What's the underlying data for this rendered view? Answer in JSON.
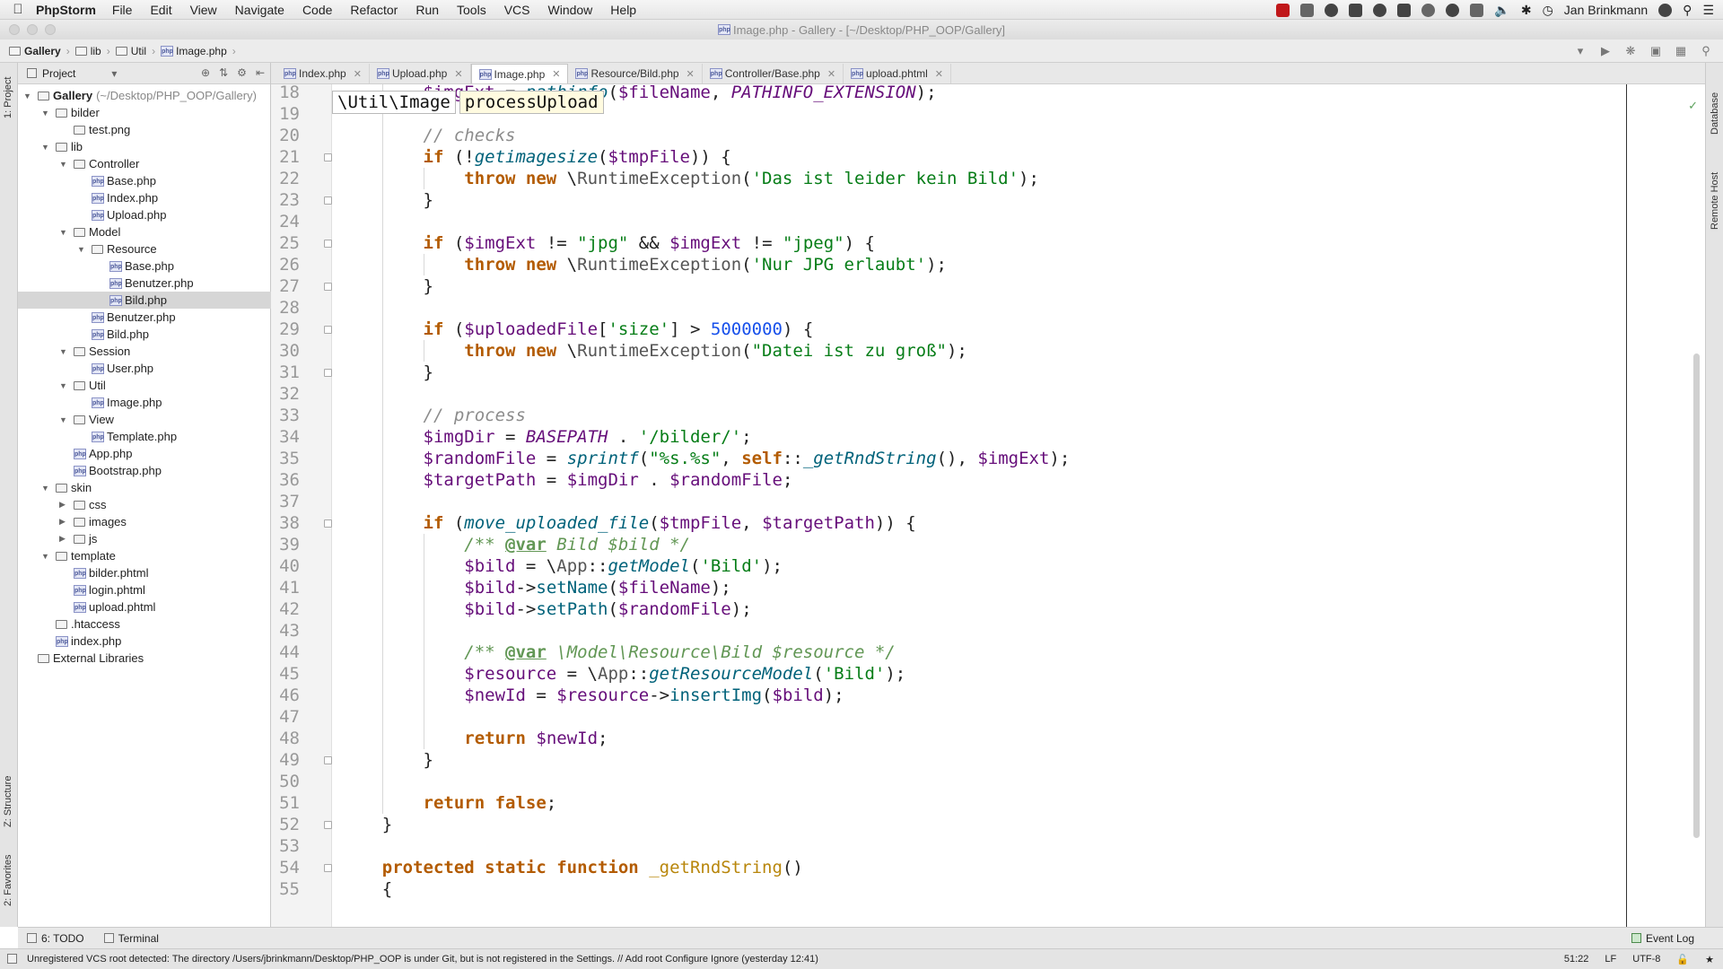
{
  "menubar": {
    "app_name": "PhpStorm",
    "items": [
      "File",
      "Edit",
      "View",
      "Navigate",
      "Code",
      "Refactor",
      "Run",
      "Tools",
      "VCS",
      "Window",
      "Help"
    ],
    "user": "Jan Brinkmann"
  },
  "window": {
    "title": "Image.php - Gallery - [~/Desktop/PHP_OOP/Gallery]"
  },
  "navbar": {
    "crumbs": [
      "Gallery",
      "lib",
      "Util",
      "Image.php"
    ]
  },
  "left_strip": {
    "project": "1: Project",
    "structure": "Z: Structure",
    "favorites": "2: Favorites"
  },
  "right_strip": {
    "database": "Database",
    "remote_host": "Remote Host"
  },
  "project_panel": {
    "title": "Project",
    "tree": [
      {
        "label": "Gallery",
        "hint": "(~/Desktop/PHP_OOP/Gallery)",
        "depth": 0,
        "type": "folder",
        "expanded": true,
        "bold": true
      },
      {
        "label": "bilder",
        "depth": 1,
        "type": "folder",
        "expanded": true
      },
      {
        "label": "test.png",
        "depth": 2,
        "type": "file"
      },
      {
        "label": "lib",
        "depth": 1,
        "type": "folder",
        "expanded": true
      },
      {
        "label": "Controller",
        "depth": 2,
        "type": "folder",
        "expanded": true
      },
      {
        "label": "Base.php",
        "depth": 3,
        "type": "php"
      },
      {
        "label": "Index.php",
        "depth": 3,
        "type": "php"
      },
      {
        "label": "Upload.php",
        "depth": 3,
        "type": "php"
      },
      {
        "label": "Model",
        "depth": 2,
        "type": "folder",
        "expanded": true
      },
      {
        "label": "Resource",
        "depth": 3,
        "type": "folder",
        "expanded": true
      },
      {
        "label": "Base.php",
        "depth": 4,
        "type": "php"
      },
      {
        "label": "Benutzer.php",
        "depth": 4,
        "type": "php"
      },
      {
        "label": "Bild.php",
        "depth": 4,
        "type": "php",
        "selected": true
      },
      {
        "label": "Benutzer.php",
        "depth": 3,
        "type": "php"
      },
      {
        "label": "Bild.php",
        "depth": 3,
        "type": "php"
      },
      {
        "label": "Session",
        "depth": 2,
        "type": "folder",
        "expanded": true
      },
      {
        "label": "User.php",
        "depth": 3,
        "type": "php"
      },
      {
        "label": "Util",
        "depth": 2,
        "type": "folder",
        "expanded": true
      },
      {
        "label": "Image.php",
        "depth": 3,
        "type": "php"
      },
      {
        "label": "View",
        "depth": 2,
        "type": "folder",
        "expanded": true
      },
      {
        "label": "Template.php",
        "depth": 3,
        "type": "php"
      },
      {
        "label": "App.php",
        "depth": 2,
        "type": "php"
      },
      {
        "label": "Bootstrap.php",
        "depth": 2,
        "type": "php"
      },
      {
        "label": "skin",
        "depth": 1,
        "type": "folder",
        "expanded": true
      },
      {
        "label": "css",
        "depth": 2,
        "type": "folder",
        "expanded": false
      },
      {
        "label": "images",
        "depth": 2,
        "type": "folder",
        "expanded": false
      },
      {
        "label": "js",
        "depth": 2,
        "type": "folder",
        "expanded": false
      },
      {
        "label": "template",
        "depth": 1,
        "type": "folder",
        "expanded": true
      },
      {
        "label": "bilder.phtml",
        "depth": 2,
        "type": "php"
      },
      {
        "label": "login.phtml",
        "depth": 2,
        "type": "php"
      },
      {
        "label": "upload.phtml",
        "depth": 2,
        "type": "php"
      },
      {
        "label": ".htaccess",
        "depth": 1,
        "type": "file"
      },
      {
        "label": "index.php",
        "depth": 1,
        "type": "php"
      },
      {
        "label": "External Libraries",
        "depth": 0,
        "type": "lib"
      }
    ]
  },
  "tabs": [
    {
      "label": "Index.php",
      "active": false
    },
    {
      "label": "Upload.php",
      "active": false
    },
    {
      "label": "Image.php",
      "active": true
    },
    {
      "label": "Resource/Bild.php",
      "active": false
    },
    {
      "label": "Controller/Base.php",
      "active": false
    },
    {
      "label": "upload.phtml",
      "active": false
    }
  ],
  "editor": {
    "breadcrumbs": [
      "\\Util\\Image",
      "processUpload"
    ],
    "first_line": 18,
    "fold_lines": [
      21,
      23,
      25,
      27,
      29,
      31,
      38,
      49,
      52,
      54
    ],
    "lines": [
      [
        {
          "t": "        "
        },
        {
          "t": "$imgExt",
          "c": "var"
        },
        {
          "t": " = "
        },
        {
          "t": "pathinfo",
          "c": "fn-static"
        },
        {
          "t": "("
        },
        {
          "t": "$fileName",
          "c": "var"
        },
        {
          "t": ", "
        },
        {
          "t": "PATHINFO_EXTENSION",
          "c": "const"
        },
        {
          "t": ");"
        }
      ],
      [],
      [
        {
          "t": "        "
        },
        {
          "t": "// checks",
          "c": "cmt"
        }
      ],
      [
        {
          "t": "        "
        },
        {
          "t": "if",
          "c": "kw2"
        },
        {
          "t": " (!"
        },
        {
          "t": "getimagesize",
          "c": "fn-static"
        },
        {
          "t": "("
        },
        {
          "t": "$tmpFile",
          "c": "var"
        },
        {
          "t": ")) {"
        }
      ],
      [
        {
          "t": "            "
        },
        {
          "t": "throw new",
          "c": "kw2"
        },
        {
          "t": " \\"
        },
        {
          "t": "RuntimeException",
          "c": "cls"
        },
        {
          "t": "("
        },
        {
          "t": "'Das ist leider kein Bild'",
          "c": "str"
        },
        {
          "t": ");"
        }
      ],
      [
        {
          "t": "        }"
        }
      ],
      [],
      [
        {
          "t": "        "
        },
        {
          "t": "if",
          "c": "kw2"
        },
        {
          "t": " ("
        },
        {
          "t": "$imgExt",
          "c": "var"
        },
        {
          "t": " != "
        },
        {
          "t": "\"jpg\"",
          "c": "str"
        },
        {
          "t": " && "
        },
        {
          "t": "$imgExt",
          "c": "var"
        },
        {
          "t": " != "
        },
        {
          "t": "\"jpeg\"",
          "c": "str"
        },
        {
          "t": ") {"
        }
      ],
      [
        {
          "t": "            "
        },
        {
          "t": "throw new",
          "c": "kw2"
        },
        {
          "t": " \\"
        },
        {
          "t": "RuntimeException",
          "c": "cls"
        },
        {
          "t": "("
        },
        {
          "t": "'Nur JPG erlaubt'",
          "c": "str"
        },
        {
          "t": ");"
        }
      ],
      [
        {
          "t": "        }"
        }
      ],
      [],
      [
        {
          "t": "        "
        },
        {
          "t": "if",
          "c": "kw2"
        },
        {
          "t": " ("
        },
        {
          "t": "$uploadedFile",
          "c": "var"
        },
        {
          "t": "["
        },
        {
          "t": "'size'",
          "c": "str"
        },
        {
          "t": "] > "
        },
        {
          "t": "5000000",
          "c": "num"
        },
        {
          "t": ") {"
        }
      ],
      [
        {
          "t": "            "
        },
        {
          "t": "throw new",
          "c": "kw2"
        },
        {
          "t": " \\"
        },
        {
          "t": "RuntimeException",
          "c": "cls"
        },
        {
          "t": "("
        },
        {
          "t": "\"Datei ist zu groß\"",
          "c": "str"
        },
        {
          "t": ");"
        }
      ],
      [
        {
          "t": "        }"
        }
      ],
      [],
      [
        {
          "t": "        "
        },
        {
          "t": "// process",
          "c": "cmt"
        }
      ],
      [
        {
          "t": "        "
        },
        {
          "t": "$imgDir",
          "c": "var"
        },
        {
          "t": " = "
        },
        {
          "t": "BASEPATH",
          "c": "const"
        },
        {
          "t": " . "
        },
        {
          "t": "'/bilder/'",
          "c": "str"
        },
        {
          "t": ";"
        }
      ],
      [
        {
          "t": "        "
        },
        {
          "t": "$randomFile",
          "c": "var"
        },
        {
          "t": " = "
        },
        {
          "t": "sprintf",
          "c": "fn-static"
        },
        {
          "t": "("
        },
        {
          "t": "\"%s.%s\"",
          "c": "str"
        },
        {
          "t": ", "
        },
        {
          "t": "self",
          "c": "kw2"
        },
        {
          "t": "::"
        },
        {
          "t": "_getRndString",
          "c": "fn-static"
        },
        {
          "t": "(), "
        },
        {
          "t": "$imgExt",
          "c": "var"
        },
        {
          "t": ");"
        }
      ],
      [
        {
          "t": "        "
        },
        {
          "t": "$targetPath",
          "c": "var"
        },
        {
          "t": " = "
        },
        {
          "t": "$imgDir",
          "c": "var"
        },
        {
          "t": " . "
        },
        {
          "t": "$randomFile",
          "c": "var"
        },
        {
          "t": ";"
        }
      ],
      [],
      [
        {
          "t": "        "
        },
        {
          "t": "if",
          "c": "kw2"
        },
        {
          "t": " ("
        },
        {
          "t": "move_uploaded_file",
          "c": "fn-static"
        },
        {
          "t": "("
        },
        {
          "t": "$tmpFile",
          "c": "var"
        },
        {
          "t": ", "
        },
        {
          "t": "$targetPath",
          "c": "var"
        },
        {
          "t": ")) {"
        }
      ],
      [
        {
          "t": "            "
        },
        {
          "t": "/** ",
          "c": "doc"
        },
        {
          "t": "@var",
          "c": "doctag"
        },
        {
          "t": " Bild $bild */",
          "c": "doc"
        }
      ],
      [
        {
          "t": "            "
        },
        {
          "t": "$bild",
          "c": "var"
        },
        {
          "t": " = \\"
        },
        {
          "t": "App",
          "c": "cls"
        },
        {
          "t": "::"
        },
        {
          "t": "getModel",
          "c": "fn-static"
        },
        {
          "t": "("
        },
        {
          "t": "'Bild'",
          "c": "str"
        },
        {
          "t": ");"
        }
      ],
      [
        {
          "t": "            "
        },
        {
          "t": "$bild",
          "c": "var"
        },
        {
          "t": "->"
        },
        {
          "t": "setName",
          "c": "fn-call"
        },
        {
          "t": "("
        },
        {
          "t": "$fileName",
          "c": "var"
        },
        {
          "t": ");"
        }
      ],
      [
        {
          "t": "            "
        },
        {
          "t": "$bild",
          "c": "var"
        },
        {
          "t": "->"
        },
        {
          "t": "setPath",
          "c": "fn-call"
        },
        {
          "t": "("
        },
        {
          "t": "$randomFile",
          "c": "var"
        },
        {
          "t": ");"
        }
      ],
      [],
      [
        {
          "t": "            "
        },
        {
          "t": "/** ",
          "c": "doc"
        },
        {
          "t": "@var",
          "c": "doctag"
        },
        {
          "t": " \\Model\\Resource\\Bild $resource */",
          "c": "doc"
        }
      ],
      [
        {
          "t": "            "
        },
        {
          "t": "$resource",
          "c": "var"
        },
        {
          "t": " = \\"
        },
        {
          "t": "App",
          "c": "cls"
        },
        {
          "t": "::"
        },
        {
          "t": "getResourceModel",
          "c": "fn-static"
        },
        {
          "t": "("
        },
        {
          "t": "'Bild'",
          "c": "str"
        },
        {
          "t": ");"
        }
      ],
      [
        {
          "t": "            "
        },
        {
          "t": "$newId",
          "c": "var"
        },
        {
          "t": " = "
        },
        {
          "t": "$resource",
          "c": "var"
        },
        {
          "t": "->"
        },
        {
          "t": "insertImg",
          "c": "fn-call"
        },
        {
          "t": "("
        },
        {
          "t": "$bild",
          "c": "var"
        },
        {
          "t": ");"
        }
      ],
      [],
      [
        {
          "t": "            "
        },
        {
          "t": "return",
          "c": "kw2"
        },
        {
          "t": " "
        },
        {
          "t": "$newId",
          "c": "var"
        },
        {
          "t": ";"
        }
      ],
      [
        {
          "t": "        }"
        }
      ],
      [],
      [
        {
          "t": "        "
        },
        {
          "t": "return false",
          "c": "kw2"
        },
        {
          "t": ";"
        }
      ],
      [
        {
          "t": "    }"
        }
      ],
      [],
      [
        {
          "t": "    "
        },
        {
          "t": "protected static function",
          "c": "kw2"
        },
        {
          "t": " "
        },
        {
          "t": "_getRndString",
          "c": "fn-def"
        },
        {
          "t": "()"
        }
      ],
      [
        {
          "t": "    {"
        }
      ]
    ]
  },
  "bottombar": {
    "todo": "6: TODO",
    "terminal": "Terminal",
    "event_log": "Event Log"
  },
  "statusbar": {
    "message": "Unregistered VCS root detected: The directory /Users/jbrinkmann/Desktop/PHP_OOP is under Git, but is not registered in the Settings. // Add root  Configure  Ignore (yesterday 12:41)",
    "position": "51:22",
    "line_sep": "LF",
    "encoding": "UTF-8"
  }
}
